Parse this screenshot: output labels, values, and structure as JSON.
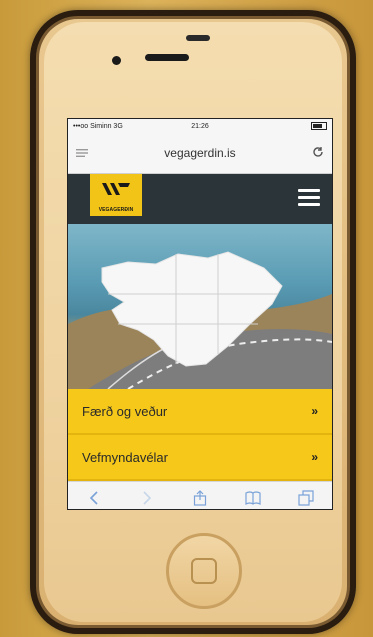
{
  "status_bar": {
    "carrier": "•••oo Siminn 3G",
    "time": "21:26"
  },
  "address_bar": {
    "url": "vegagerdin.is"
  },
  "header": {
    "logo_text": "VEGAGERÐIN",
    "menu_icon": "hamburger-icon"
  },
  "hero": {
    "image": "iceland-map-road-photo"
  },
  "nav": {
    "items": [
      {
        "label": "Færð og veður",
        "arrow": "»"
      },
      {
        "label": "Vefmyndavélar",
        "arrow": "»"
      }
    ]
  },
  "toolbar": {
    "icons": [
      "back-icon",
      "forward-icon",
      "share-icon",
      "bookmarks-icon",
      "tabs-icon"
    ]
  },
  "colors": {
    "accent": "#f5c81a",
    "header_bg": "#2b3439"
  }
}
